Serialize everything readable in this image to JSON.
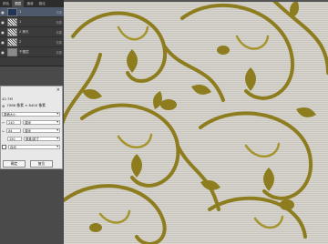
{
  "layers_panel": {
    "tabs": [
      "颜色",
      "图层",
      "通道",
      "路径",
      "历史"
    ],
    "active_tab": 1,
    "rows": [
      {
        "name": "1",
        "fx": "效果",
        "thumb": "dark",
        "selected": true
      },
      {
        "name": "1",
        "fx": "效果",
        "thumb": "checker",
        "selected": false
      },
      {
        "name": "2 拷贝",
        "fx": "效果",
        "thumb": "checker",
        "selected": false
      },
      {
        "name": "2",
        "fx": "效果",
        "thumb": "checker",
        "selected": false
      },
      {
        "name": "干图层",
        "fx": "效果",
        "thumb": "gray",
        "selected": false
      }
    ]
  },
  "dialog": {
    "size_label": "42.7M",
    "dimensions_label": "7086 像素 × 8400 像素",
    "fit_label": "原稿大小",
    "width_value": "240",
    "width_unit": "厘米",
    "height_value": "84",
    "height_unit": "厘米",
    "resolution_value": "150",
    "resolution_unit": "像素/英寸",
    "resample_label": "自动",
    "ok_label": "确定",
    "cancel_label": "复位"
  },
  "colors": {
    "pattern_gold": "#8e7d1e",
    "pattern_gold_light": "#a6952e",
    "background_silver": "#d1cec6"
  }
}
